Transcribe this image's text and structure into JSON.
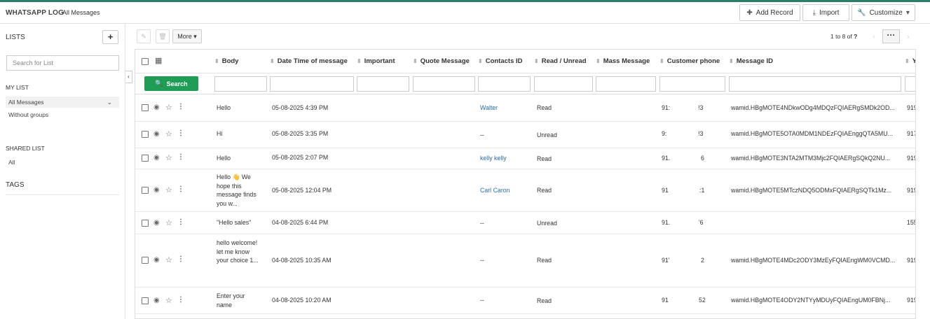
{
  "header": {
    "app_title": "WHATSAPP LOG",
    "breadcrumb_sep": "›",
    "breadcrumb": "All Messages",
    "add_record": "Add Record",
    "import": "Import",
    "customize": "Customize"
  },
  "sidebar": {
    "lists_title": "LISTS",
    "add_icon": "+",
    "search_placeholder": "Search for List",
    "my_list_label": "MY LIST",
    "my_list_items": [
      "All Messages",
      "Without groups"
    ],
    "shared_list_label": "SHARED LIST",
    "shared_items": [
      "All"
    ],
    "tags_label": "TAGS",
    "collapse_icon": "‹"
  },
  "toolbar": {
    "more_label": "More ▾",
    "pager_text": "1 to 8  of",
    "pager_total": "?",
    "prev_icon": "‹",
    "next_icon": "›",
    "dots_icon": "···"
  },
  "grid": {
    "search_label": "Search",
    "columns": [
      "Body",
      "Date Time of message",
      "Important",
      "Quote Message",
      "Contacts ID",
      "Read / Unread",
      "Mass Message",
      "Customer phone",
      "Message ID",
      "Y"
    ],
    "rows": [
      {
        "body": "Hello",
        "date": "05-08-2025 4:39 PM",
        "contact": "Walter",
        "read": "Read",
        "phone_a": "91:",
        "phone_b": "!3",
        "message_id": "wamid.HBgMOTE4NDkwODg4MDQzFQIAERgSMDk2OD...",
        "extra": "919"
      },
      {
        "body": "Hi",
        "date": "05-08-2025 3:35 PM",
        "contact": "--",
        "read": "Unread",
        "phone_a": "9:",
        "phone_b": "!3",
        "message_id": "wamid.HBgMOTE5OTA0MDM1NDEzFQIAEnggQTA5MU...",
        "extra": "917"
      },
      {
        "body": "Hello",
        "date": "05-08-2025 2:07 PM",
        "contact": "kelly kelly",
        "read": "Read",
        "phone_a": "91.",
        "phone_b": "6",
        "message_id": "wamid.HBgMOTE3NTA2MTM3Mjc2FQIAERgSQkQ2NU...",
        "extra": "919"
      },
      {
        "body": "Hello 👋 We hope this message finds you w...",
        "date": "05-08-2025 12:04 PM",
        "contact": "Carl Caron",
        "read": "Read",
        "phone_a": "91",
        "phone_b": ":1",
        "message_id": "wamid.HBgMOTE5MTczNDQ5ODMxFQIAERgSQTk1Mz...",
        "extra": "919"
      },
      {
        "body": "\"Hello sales\"",
        "date": "04-08-2025 6:44 PM",
        "contact": "--",
        "read": "Unread",
        "phone_a": "91.",
        "phone_b": "'6",
        "message_id": "",
        "extra": "155"
      },
      {
        "body": "hello welcome! let me know your choice 1...",
        "date": "04-08-2025 10:35 AM",
        "contact": "--",
        "read": "Read",
        "phone_a": "91'",
        "phone_b": "2",
        "message_id": "wamid.HBgMOTE4MDc2ODY3MzEyFQIAEngWM0VCMD...",
        "extra": "919"
      },
      {
        "body": "Enter your name",
        "date": "04-08-2025 10:20 AM",
        "contact": "--",
        "read": "Read",
        "phone_a": "91",
        "phone_b": "52",
        "message_id": "wamid.HBgMOTE4ODY2NTYyMDUyFQIAEngUM0FBNj...",
        "extra": "919"
      }
    ]
  },
  "colors": {
    "accent": "#1f9d55",
    "link": "#2b6cb0",
    "topline": "#2e7d6a"
  },
  "icons": [
    "plus-icon",
    "download-icon",
    "wrench-icon",
    "pencil-icon",
    "trash-icon",
    "grid-icon",
    "search-icon",
    "eye-icon",
    "star-icon",
    "kebab-icon",
    "sort-icon"
  ]
}
